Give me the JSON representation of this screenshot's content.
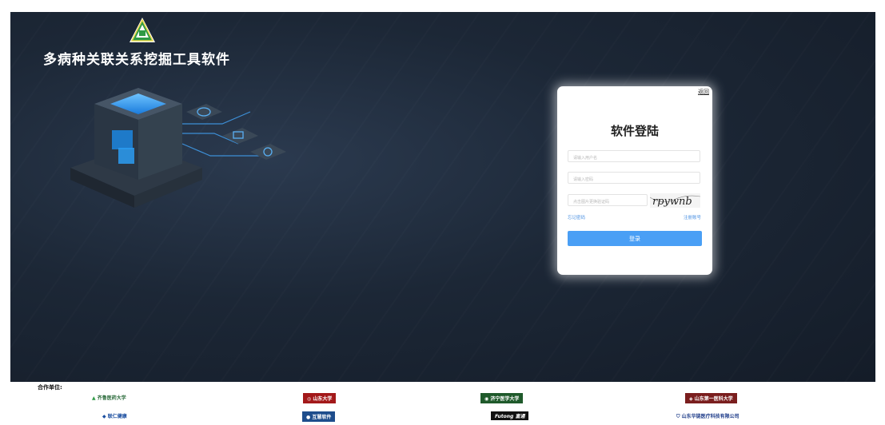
{
  "app": {
    "title": "多病种关联关系挖掘工具软件"
  },
  "login": {
    "title": "软件登陆",
    "back_label": "返回",
    "username_placeholder": "请输入用户名",
    "password_placeholder": "请输入密码",
    "captcha_placeholder": "点击图片更换验证码",
    "captcha_text": "rpywnb",
    "forgot_label": "忘记密码",
    "register_label": "注册账号",
    "submit_label": "登录"
  },
  "partners": {
    "label": "合作单位:",
    "items": [
      {
        "name": "齐鲁医药大学",
        "color": "#2a6a3a"
      },
      {
        "name": "山东大学",
        "color": "#a3191a"
      },
      {
        "name": "济宁医学大学",
        "color": "#1f5a2b"
      },
      {
        "name": "山东第一医科大学",
        "color": "#7a1e1e"
      },
      {
        "name": "联仁健康",
        "color": "#1c4fa0"
      },
      {
        "name": "互慧软件",
        "color": "#1e4d8c"
      },
      {
        "name": "Futong 富通",
        "color": "#ffffff"
      },
      {
        "name": "山东华链医疗科技有限公司",
        "color": "#1f3d8a"
      }
    ]
  },
  "colors": {
    "accent": "#4a9ff5",
    "hero_bg": "#1c2736"
  }
}
